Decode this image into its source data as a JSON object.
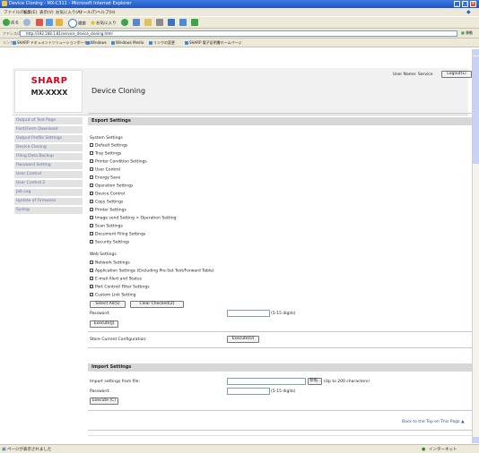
{
  "browser": {
    "title": "Device Cloning - MX-C311 - Microsoft Internet Explorer",
    "menus": [
      "ファイル(F)",
      "編集(E)",
      "表示(V)",
      "お気に入り(A)",
      "ツール(T)",
      "ヘルプ(H)"
    ],
    "toolbar": {
      "back": "戻る",
      "search": "検索",
      "favorites": "お気に入り"
    },
    "address_label": "アドレス(D)",
    "address_url": "http://192.168.1.81/service_device_cloning.html",
    "go_label": "移動",
    "links_label": "リンク",
    "links": [
      "SHARP ドキュメントソリューションポータル",
      "Windows",
      "Windows Media",
      "リンクの変更",
      "SHARP 電子証明書ホームページ"
    ],
    "status_left": "ページが表示されました",
    "status_right": "インターネット"
  },
  "header": {
    "brand": "SHARP",
    "model": "MX-XXXX",
    "page_title": "Device Cloning",
    "user_name": "User Name: Service",
    "logout": "Logout(L)"
  },
  "sidebar": {
    "items": [
      {
        "label": "Output of Test Page"
      },
      {
        "label": "Font/Form Download"
      },
      {
        "label": "Output Profile Settings"
      },
      {
        "label": "Device Cloning"
      },
      {
        "label": "Filing Data Backup"
      },
      {
        "label": "Password Setting"
      },
      {
        "label": "User Control"
      },
      {
        "label": "User Control 2"
      },
      {
        "label": "Job Log"
      },
      {
        "label": "Update of Firmware"
      },
      {
        "label": "Syslog"
      }
    ]
  },
  "export": {
    "title": "Export Settings",
    "system_label": "System Settings",
    "system_items": [
      "Default Settings",
      "Tray Settings",
      "Printer Condition Settings",
      "User Control",
      "Energy Save",
      "Operation Settings",
      "Device Control",
      "Copy Settings",
      "Printer Settings",
      "Image send Setting > Operation Setting",
      "Scan Settings",
      "Document Filing Settings",
      "Security Settings"
    ],
    "web_label": "Web Settings",
    "web_items": [
      "Network Settings",
      "Application Settings (Excluding Pre-Set Text/Forward Table)",
      "E-mail Alert and Status",
      "Port Control/ Filter Settings",
      "Custom Link Setting"
    ],
    "select_all": "Select All(S)",
    "clear_checked": "Clear Checked(Z)",
    "password_label": "Password:",
    "password_hint": "(5-15 digits)",
    "execute": "Execute(J)",
    "store_label": "Store Current Configuration:",
    "store_execute": "Execute(U)"
  },
  "import": {
    "title": "Import Settings",
    "file_label": "Import settings from file:",
    "browse": "参照...",
    "file_hint": "(Up to 200 characters)",
    "password_label": "Password:",
    "password_hint": "(5-15 digits)",
    "execute": "Execute (C)"
  },
  "back_to_top": "Back to the Top on This Page ▲"
}
